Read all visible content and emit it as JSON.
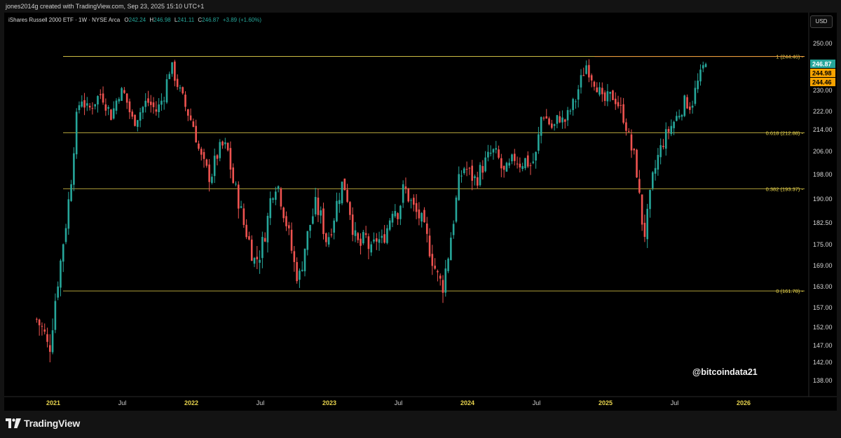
{
  "header": {
    "credit": "jones2014g created with TradingView.com, Sep 23, 2025 15:10 UTC+1"
  },
  "symbol": {
    "name": "iShares Russell 2000 ETF · 1W · NYSE Arca",
    "ohlc": [
      {
        "k": "O",
        "v": "242.24"
      },
      {
        "k": "H",
        "v": "246.98"
      },
      {
        "k": "L",
        "v": "241.11"
      },
      {
        "k": "C",
        "v": "246.87"
      }
    ],
    "change": "+3.89 (+1.60%)"
  },
  "currency_button": "USD",
  "watermark": "@bitcoindata21",
  "footer": {
    "brand": "TradingView"
  },
  "colors": {
    "up": "#26a69a",
    "down": "#ef5350",
    "fib": "#e8d44d",
    "hline": "#e89a3c",
    "last_price_bg": "#26a69a",
    "tag_bg": "#f7a300"
  },
  "chart_data": {
    "type": "candlestick",
    "interval": "1W",
    "price_scale": {
      "ticks": [
        138.0,
        142.0,
        147.0,
        152.0,
        157.0,
        163.0,
        169.0,
        175.0,
        182.5,
        190.0,
        198.0,
        206.0,
        214.0,
        222.0,
        230.0,
        250.0
      ],
      "range": [
        136,
        251
      ]
    },
    "time_axis": [
      "2021",
      "Jul",
      "2022",
      "Jul",
      "2023",
      "Jul",
      "2024",
      "Jul",
      "2025",
      "Jul",
      "2026"
    ],
    "fib_levels": [
      {
        "label": "1 (244.46)",
        "price": 244.46
      },
      {
        "label": "0.618 (212.88)",
        "price": 212.88
      },
      {
        "label": "0.382 (193.37)",
        "price": 193.37
      },
      {
        "label": "0 (161.78)",
        "price": 161.78
      }
    ],
    "horizontal_line": {
      "price": 244.46,
      "from_year": 2024.92
    },
    "price_tags": [
      {
        "text": "246.87",
        "price": 246.87,
        "kind": "last"
      },
      {
        "text": "244.98",
        "price": 244.98,
        "kind": "tag"
      },
      {
        "text": "244.46",
        "price": 244.46,
        "kind": "tag"
      }
    ],
    "anchors": [
      [
        2020.88,
        154
      ],
      [
        2020.93,
        151
      ],
      [
        2020.97,
        145
      ],
      [
        2021.0,
        155
      ],
      [
        2021.03,
        164
      ],
      [
        2021.06,
        172
      ],
      [
        2021.1,
        185
      ],
      [
        2021.13,
        197
      ],
      [
        2021.17,
        220
      ],
      [
        2021.2,
        228
      ],
      [
        2021.25,
        222
      ],
      [
        2021.3,
        226
      ],
      [
        2021.35,
        229
      ],
      [
        2021.42,
        220
      ],
      [
        2021.48,
        230
      ],
      [
        2021.52,
        228
      ],
      [
        2021.58,
        217
      ],
      [
        2021.63,
        222
      ],
      [
        2021.68,
        226
      ],
      [
        2021.75,
        222
      ],
      [
        2021.8,
        228
      ],
      [
        2021.85,
        241
      ],
      [
        2021.88,
        236
      ],
      [
        2021.92,
        229
      ],
      [
        2021.97,
        222
      ],
      [
        2022.02,
        215
      ],
      [
        2022.06,
        205
      ],
      [
        2022.1,
        200
      ],
      [
        2022.14,
        197
      ],
      [
        2022.18,
        204
      ],
      [
        2022.22,
        208
      ],
      [
        2022.26,
        207
      ],
      [
        2022.3,
        196
      ],
      [
        2022.34,
        190
      ],
      [
        2022.38,
        182
      ],
      [
        2022.42,
        176
      ],
      [
        2022.46,
        170
      ],
      [
        2022.5,
        173
      ],
      [
        2022.54,
        180
      ],
      [
        2022.58,
        192
      ],
      [
        2022.62,
        196
      ],
      [
        2022.66,
        188
      ],
      [
        2022.7,
        180
      ],
      [
        2022.74,
        170
      ],
      [
        2022.78,
        165
      ],
      [
        2022.82,
        174
      ],
      [
        2022.86,
        182
      ],
      [
        2022.9,
        188
      ],
      [
        2022.94,
        184
      ],
      [
        2022.98,
        176
      ],
      [
        2023.02,
        182
      ],
      [
        2023.06,
        190
      ],
      [
        2023.1,
        196
      ],
      [
        2023.14,
        189
      ],
      [
        2023.18,
        178
      ],
      [
        2023.22,
        174
      ],
      [
        2023.26,
        178
      ],
      [
        2023.3,
        172
      ],
      [
        2023.34,
        177
      ],
      [
        2023.38,
        176
      ],
      [
        2023.42,
        181
      ],
      [
        2023.46,
        188
      ],
      [
        2023.5,
        186
      ],
      [
        2023.54,
        194
      ],
      [
        2023.58,
        190
      ],
      [
        2023.62,
        186
      ],
      [
        2023.66,
        184
      ],
      [
        2023.7,
        178
      ],
      [
        2023.74,
        172
      ],
      [
        2023.78,
        166
      ],
      [
        2023.82,
        163
      ],
      [
        2023.86,
        172
      ],
      [
        2023.9,
        184
      ],
      [
        2023.94,
        196
      ],
      [
        2023.98,
        201
      ],
      [
        2024.02,
        198
      ],
      [
        2024.06,
        196
      ],
      [
        2024.1,
        200
      ],
      [
        2024.14,
        203
      ],
      [
        2024.18,
        206
      ],
      [
        2024.22,
        204
      ],
      [
        2024.26,
        198
      ],
      [
        2024.3,
        200
      ],
      [
        2024.34,
        204
      ],
      [
        2024.38,
        202
      ],
      [
        2024.42,
        203
      ],
      [
        2024.46,
        201
      ],
      [
        2024.5,
        205
      ],
      [
        2024.54,
        222
      ],
      [
        2024.58,
        218
      ],
      [
        2024.62,
        214
      ],
      [
        2024.66,
        220
      ],
      [
        2024.7,
        217
      ],
      [
        2024.74,
        222
      ],
      [
        2024.78,
        226
      ],
      [
        2024.82,
        234
      ],
      [
        2024.86,
        241
      ],
      [
        2024.9,
        236
      ],
      [
        2024.94,
        232
      ],
      [
        2024.98,
        225
      ],
      [
        2025.02,
        227
      ],
      [
        2025.06,
        228
      ],
      [
        2025.1,
        224
      ],
      [
        2025.14,
        218
      ],
      [
        2025.18,
        208
      ],
      [
        2025.22,
        202
      ],
      [
        2025.25,
        188
      ],
      [
        2025.28,
        178
      ],
      [
        2025.31,
        186
      ],
      [
        2025.34,
        196
      ],
      [
        2025.38,
        204
      ],
      [
        2025.42,
        210
      ],
      [
        2025.46,
        214
      ],
      [
        2025.5,
        218
      ],
      [
        2025.54,
        222
      ],
      [
        2025.58,
        226
      ],
      [
        2025.62,
        224
      ],
      [
        2025.66,
        232
      ],
      [
        2025.7,
        238
      ],
      [
        2025.74,
        246.87
      ]
    ]
  }
}
